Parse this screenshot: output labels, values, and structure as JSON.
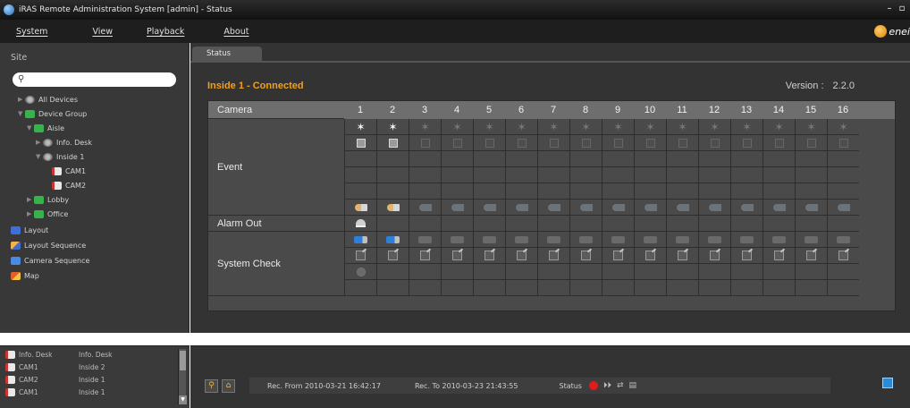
{
  "window": {
    "title": "iRAS Remote Administration System [admin] - Status"
  },
  "menu": [
    "System",
    "View",
    "Playback",
    "About"
  ],
  "brand": {
    "text": "enei"
  },
  "sidebar": {
    "site_label": "Site",
    "search_placeholder": "",
    "tree": [
      {
        "label": "All Devices",
        "icon": "device-icon"
      },
      {
        "label": "Device Group",
        "icon": "group-icon"
      },
      {
        "label": "Aisle",
        "icon": "group-icon"
      },
      {
        "label": "Info. Desk",
        "icon": "device-icon"
      },
      {
        "label": "Inside 1",
        "icon": "device-icon"
      },
      {
        "label": "CAM1",
        "icon": "camera-icon"
      },
      {
        "label": "CAM2",
        "icon": "camera-icon"
      },
      {
        "label": "Lobby",
        "icon": "group-icon"
      },
      {
        "label": "Office",
        "icon": "group-icon"
      },
      {
        "label": "Layout",
        "icon": "layout-icon"
      },
      {
        "label": "Layout Sequence",
        "icon": "layout-sequence-icon"
      },
      {
        "label": "Camera Sequence",
        "icon": "camera-sequence-icon"
      },
      {
        "label": "Map",
        "icon": "map-icon"
      }
    ],
    "mini_list": [
      {
        "camera": "Info. Desk",
        "device": "Info. Desk"
      },
      {
        "camera": "CAM1",
        "device": "Inside 2"
      },
      {
        "camera": "CAM2",
        "device": "Inside 1"
      },
      {
        "camera": "CAM1",
        "device": "Inside 1"
      }
    ]
  },
  "tab": {
    "label": "Status"
  },
  "panel": {
    "title": "Inside 1 - Connected",
    "version_label": "Version :",
    "version_value": "2.2.0",
    "camera_label": "Camera",
    "event_label": "Event",
    "alarm_label": "Alarm Out",
    "system_label": "System Check",
    "columns": [
      "1",
      "2",
      "3",
      "4",
      "5",
      "6",
      "7",
      "8",
      "9",
      "10",
      "11",
      "12",
      "13",
      "14",
      "15",
      "16"
    ],
    "active_channels": [
      1,
      2
    ]
  },
  "status_bar": {
    "rec_from": "Rec. From 2010-03-21 16:42:17",
    "rec_to": "Rec. To 2010-03-23 21:43:55",
    "status_label": "Status"
  },
  "colors": {
    "accent": "#f0a020",
    "record": "#e21b1b",
    "title_bg": "#111111",
    "panel_bg": "#4a4a4a"
  }
}
